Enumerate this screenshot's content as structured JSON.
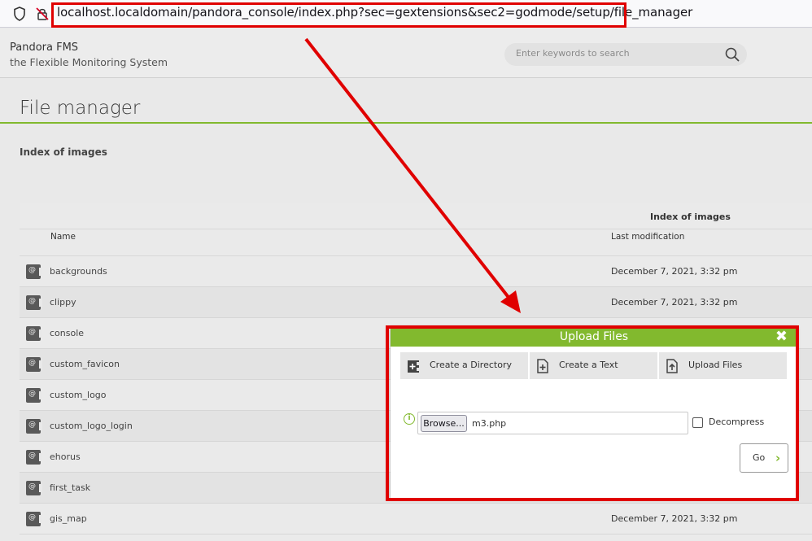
{
  "browser": {
    "url": "localhost.localdomain/pandora_console/index.php?sec=gextensions&sec2=godmode/setup/file_manager"
  },
  "header": {
    "brand_title": "Pandora FMS",
    "brand_subtitle": "the Flexible Monitoring System",
    "search_placeholder": "Enter keywords to search"
  },
  "page": {
    "title": "File manager",
    "section_label": "Index of images"
  },
  "table": {
    "title": "Index of images",
    "columns": {
      "name": "Name",
      "modified": "Last modification"
    },
    "rows": [
      {
        "name": "backgrounds",
        "date": "December 7, 2021, 3:32 pm"
      },
      {
        "name": "clippy",
        "date": "December 7, 2021, 3:32 pm"
      },
      {
        "name": "console",
        "date": ""
      },
      {
        "name": "custom_favicon",
        "date": ""
      },
      {
        "name": "custom_logo",
        "date": ""
      },
      {
        "name": "custom_logo_login",
        "date": ""
      },
      {
        "name": "ehorus",
        "date": ""
      },
      {
        "name": "first_task",
        "date": ""
      },
      {
        "name": "gis_map",
        "date": "December 7, 2021, 3:32 pm"
      }
    ]
  },
  "dialog": {
    "title": "Upload Files",
    "tabs": [
      {
        "label": "Create a Directory",
        "icon": "create-directory-icon"
      },
      {
        "label": "Create a Text",
        "icon": "create-text-icon"
      },
      {
        "label": "Upload Files",
        "icon": "upload-file-icon"
      }
    ],
    "browse_label": "Browse...",
    "file_name": "m3.php",
    "decompress_label": "Decompress",
    "go_label": "Go"
  },
  "colors": {
    "accent": "#82b92e",
    "annotation": "#e00000"
  }
}
